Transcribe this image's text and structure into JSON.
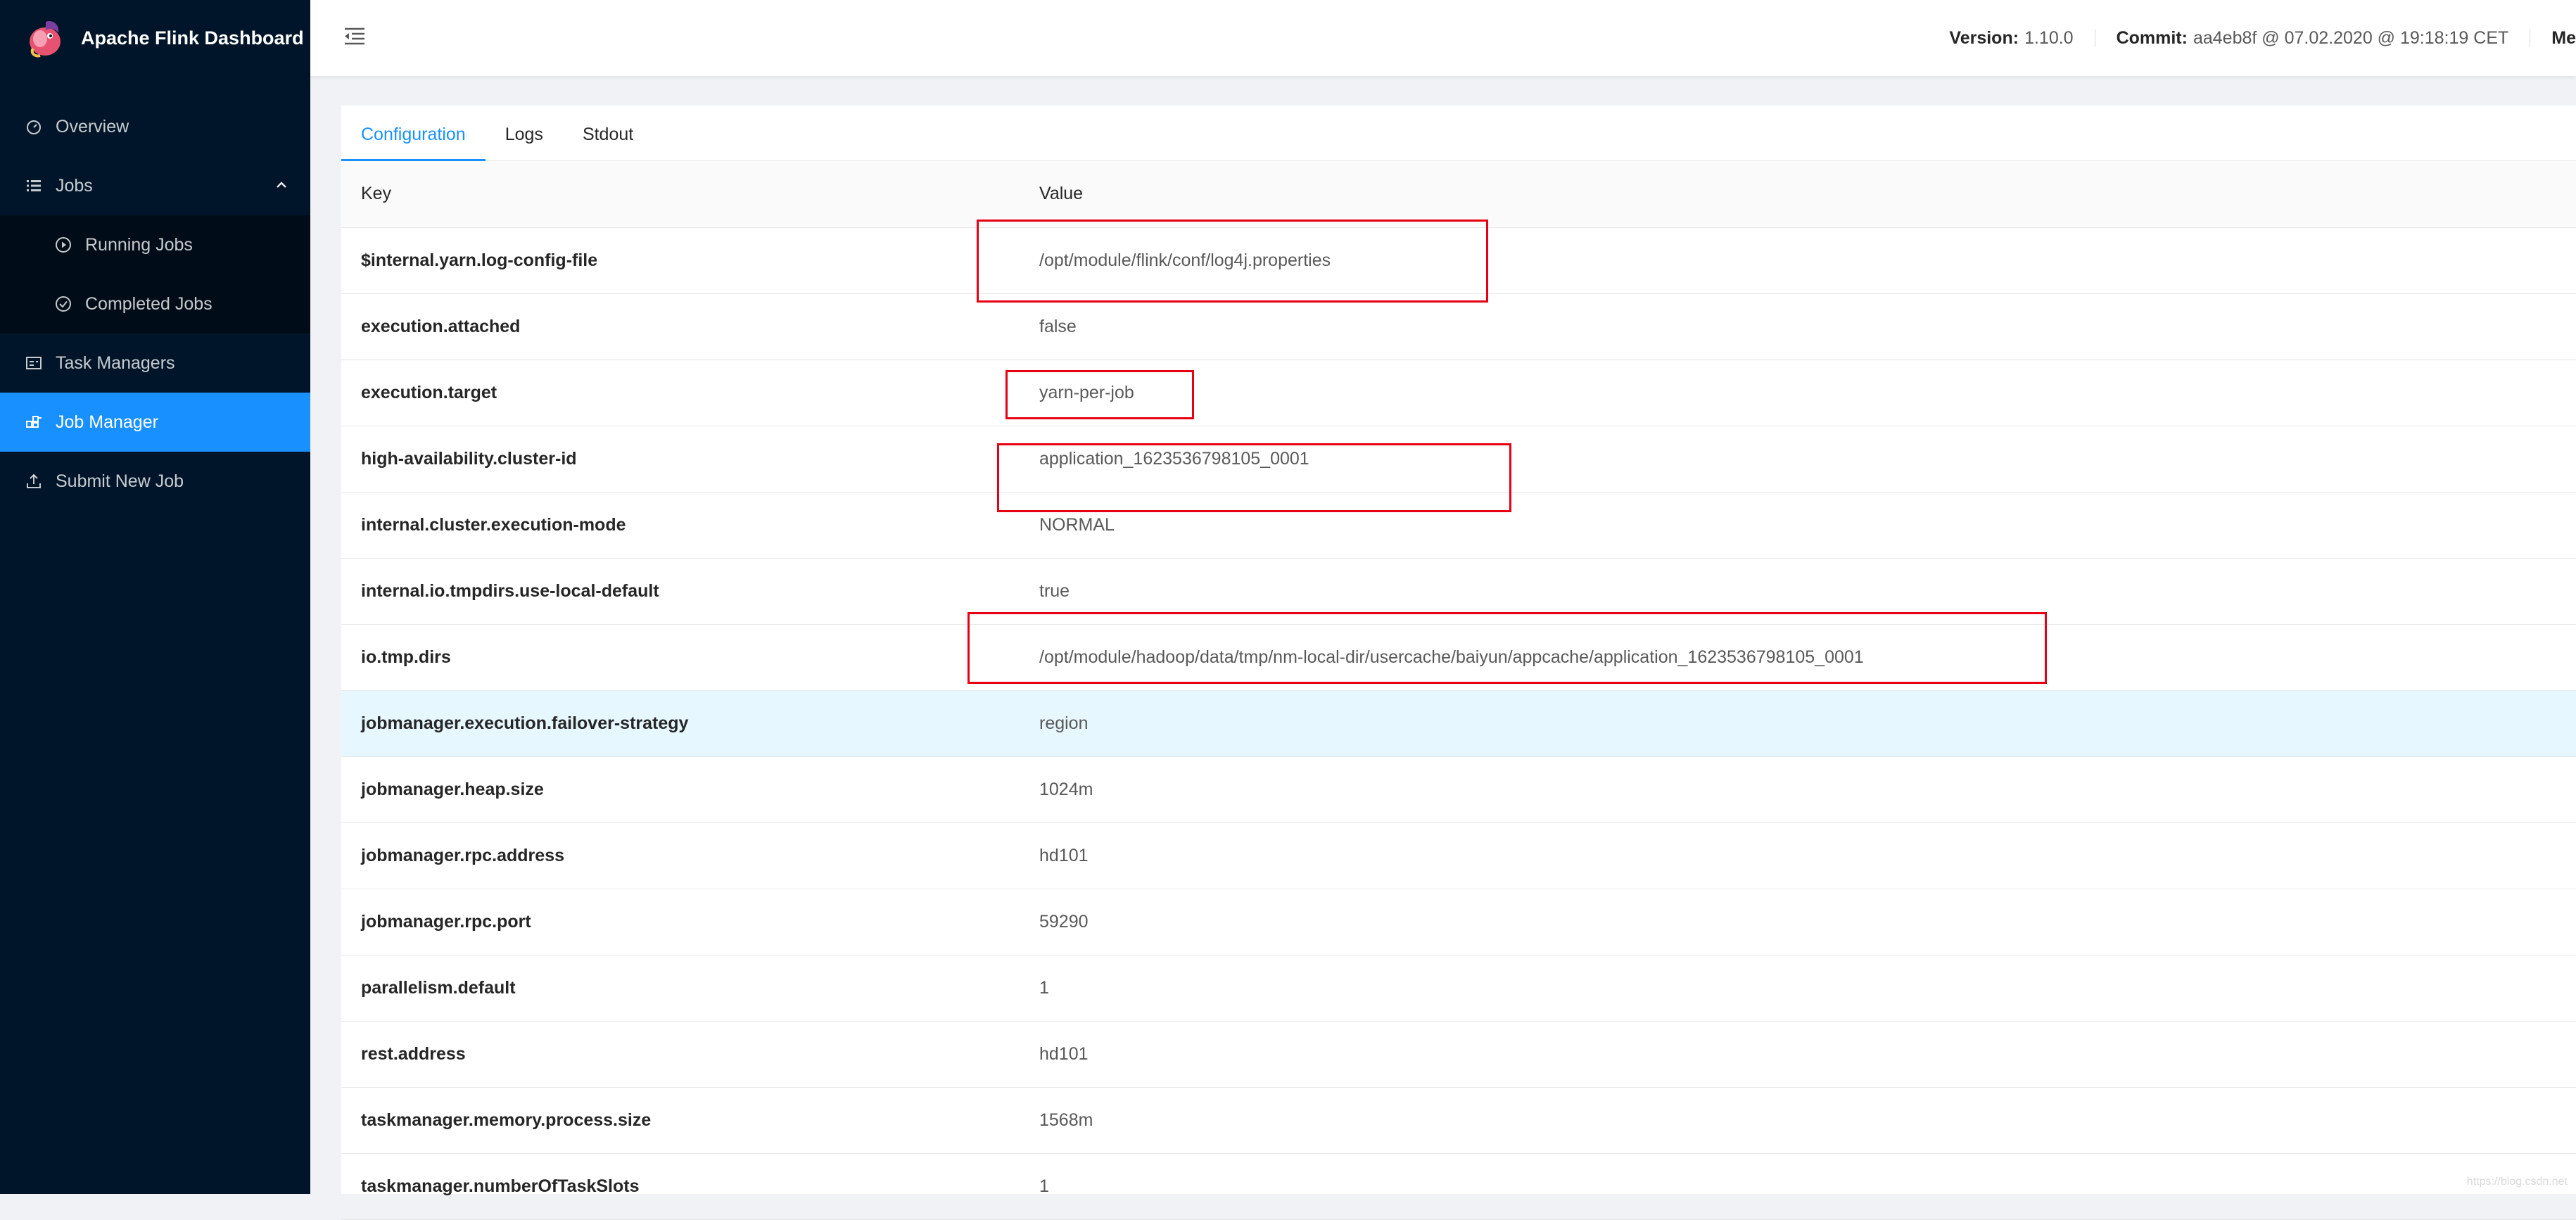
{
  "app": {
    "title": "Apache Flink Dashboard"
  },
  "sidebar": {
    "items": [
      {
        "label": "Overview",
        "icon": "dashboard-icon"
      },
      {
        "label": "Jobs",
        "icon": "list-icon"
      },
      {
        "label": "Running Jobs",
        "icon": "play-circle-icon"
      },
      {
        "label": "Completed Jobs",
        "icon": "check-circle-icon"
      },
      {
        "label": "Task Managers",
        "icon": "schedule-icon"
      },
      {
        "label": "Job Manager",
        "icon": "cluster-icon"
      },
      {
        "label": "Submit New Job",
        "icon": "upload-icon"
      }
    ]
  },
  "header": {
    "version_label": "Version:",
    "version_value": "1.10.0",
    "commit_label": "Commit:",
    "commit_value": "aa4eb8f @ 07.02.2020 @ 19:18:19 CET",
    "truncated_label": "Me"
  },
  "tabs": [
    {
      "label": "Configuration"
    },
    {
      "label": "Logs"
    },
    {
      "label": "Stdout"
    }
  ],
  "table": {
    "headers": {
      "key": "Key",
      "value": "Value"
    },
    "rows": [
      {
        "key": "$internal.yarn.log-config-file",
        "value": "/opt/module/flink/conf/log4j.properties"
      },
      {
        "key": "execution.attached",
        "value": "false"
      },
      {
        "key": "execution.target",
        "value": "yarn-per-job"
      },
      {
        "key": "high-availability.cluster-id",
        "value": "application_1623536798105_0001"
      },
      {
        "key": "internal.cluster.execution-mode",
        "value": "NORMAL"
      },
      {
        "key": "internal.io.tmpdirs.use-local-default",
        "value": "true"
      },
      {
        "key": "io.tmp.dirs",
        "value": "/opt/module/hadoop/data/tmp/nm-local-dir/usercache/baiyun/appcache/application_1623536798105_0001"
      },
      {
        "key": "jobmanager.execution.failover-strategy",
        "value": "region"
      },
      {
        "key": "jobmanager.heap.size",
        "value": "1024m"
      },
      {
        "key": "jobmanager.rpc.address",
        "value": "hd101"
      },
      {
        "key": "jobmanager.rpc.port",
        "value": "59290"
      },
      {
        "key": "parallelism.default",
        "value": "1"
      },
      {
        "key": "rest.address",
        "value": "hd101"
      },
      {
        "key": "taskmanager.memory.process.size",
        "value": "1568m"
      },
      {
        "key": "taskmanager.numberOfTaskSlots",
        "value": "1"
      }
    ]
  },
  "colors": {
    "sidebar_bg": "#001529",
    "accent": "#1890ff",
    "highlight_row": "#e6f7ff",
    "annotation": "#e60012"
  }
}
